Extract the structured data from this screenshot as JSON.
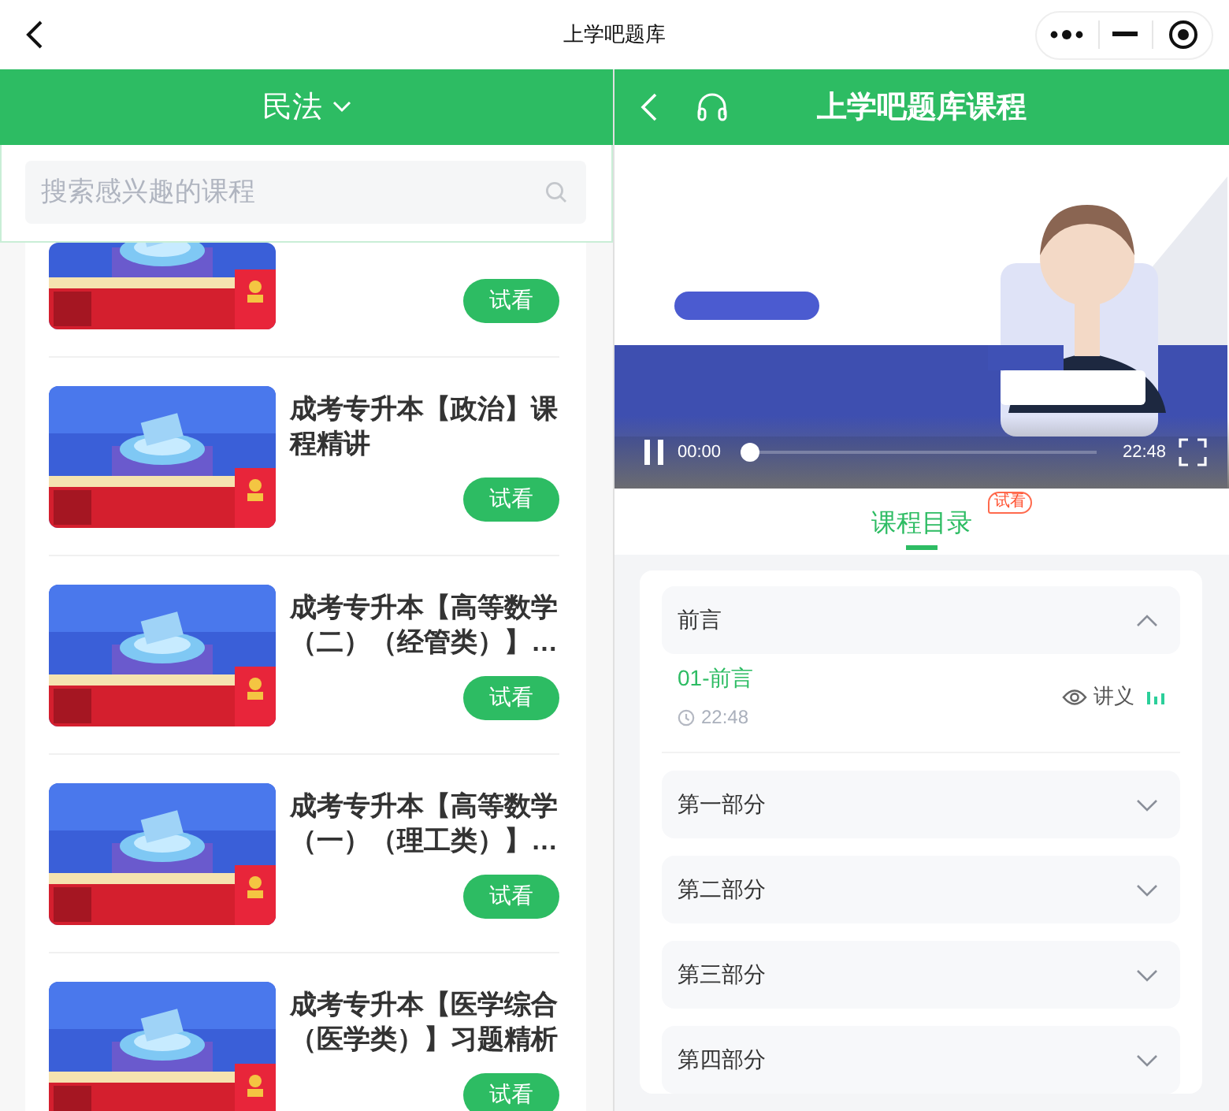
{
  "top_bar": {
    "title": "上学吧题库"
  },
  "left_panel": {
    "category": "民法",
    "search": {
      "placeholder": "搜索感兴趣的课程"
    },
    "courses": [
      {
        "button": "试看"
      },
      {
        "title": "成考专升本【政治】课程精讲",
        "button": "试看"
      },
      {
        "title": "成考专升本【高等数学（二）（经管类）】…",
        "button": "试看"
      },
      {
        "title": "成考专升本【高等数学（一）（理工类）】…",
        "button": "试看"
      },
      {
        "title": "成考专升本【医学综合（医学类）】习题精析",
        "button": "试看"
      }
    ]
  },
  "right_panel": {
    "header": {
      "title": "上学吧题库课程"
    },
    "video": {
      "kind": "picture",
      "playing": true,
      "current_time": "00:00",
      "duration": "22:48",
      "level": 0
    },
    "tabs": [
      {
        "label": "课程目录",
        "badge": "试看",
        "selected": true
      }
    ],
    "sections": [
      {
        "title": "前言",
        "expanded": true,
        "lessons": [
          {
            "title": "01-前言",
            "duration": "22:48",
            "handout": "讲义",
            "selected": true
          }
        ]
      },
      {
        "title": "第一部分",
        "expanded": false
      },
      {
        "title": "第二部分",
        "expanded": false
      },
      {
        "title": "第三部分",
        "expanded": false
      },
      {
        "title": "第四部分",
        "expanded": false
      }
    ]
  }
}
